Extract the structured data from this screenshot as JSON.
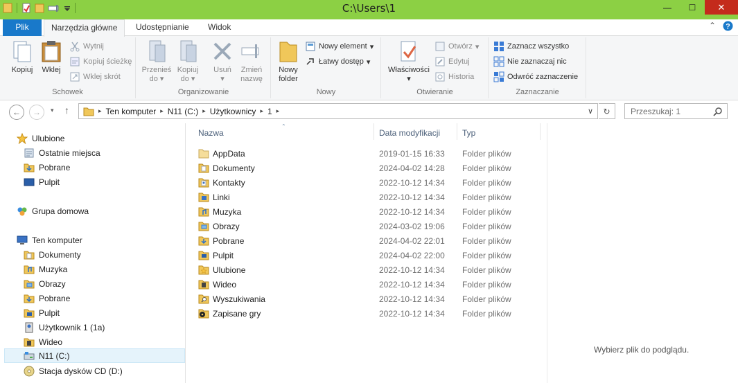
{
  "window": {
    "title": "C:\\Users\\1",
    "controls": {
      "minimize": "—",
      "maximize": "☐",
      "close": "✕"
    }
  },
  "ribbon_tabs": {
    "file": "Plik",
    "home": "Narzędzia główne",
    "share": "Udostępnianie",
    "view": "Widok"
  },
  "ribbon": {
    "clipboard": {
      "label": "Schowek",
      "copy": "Kopiuj",
      "paste": "Wklej",
      "cut": "Wytnij",
      "copy_path": "Kopiuj ścieżkę",
      "paste_shortcut": "Wklej skrót"
    },
    "organize": {
      "label": "Organizowanie",
      "move_to_l1": "Przenieś",
      "move_to_l2": "do",
      "copy_to_l1": "Kopiuj",
      "copy_to_l2": "do",
      "delete": "Usuń",
      "rename_l1": "Zmień",
      "rename_l2": "nazwę"
    },
    "new": {
      "label": "Nowy",
      "new_folder_l1": "Nowy",
      "new_folder_l2": "folder",
      "new_item": "Nowy element",
      "easy_access": "Łatwy dostęp"
    },
    "open": {
      "label": "Otwieranie",
      "properties": "Właściwości",
      "open": "Otwórz",
      "edit": "Edytuj",
      "history": "Historia"
    },
    "select": {
      "label": "Zaznaczanie",
      "select_all": "Zaznacz wszystko",
      "select_none": "Nie zaznaczaj nic",
      "invert": "Odwróć zaznaczenie"
    }
  },
  "address": {
    "crumbs": [
      "Ten komputer",
      "N11 (C:)",
      "Użytkownicy",
      "1"
    ],
    "search_placeholder": "Przeszukaj: 1"
  },
  "nav": {
    "favorites": "Ulubione",
    "recent": "Ostatnie miejsca",
    "downloads": "Pobrane",
    "desktop": "Pulpit",
    "homegroup": "Grupa domowa",
    "this_pc": "Ten komputer",
    "pc_items": [
      "Dokumenty",
      "Muzyka",
      "Obrazy",
      "Pobrane",
      "Pulpit",
      "Użytkownik 1 (1a)",
      "Wideo",
      "N11 (C:)",
      "Stacja dysków CD (D:)"
    ]
  },
  "columns": {
    "name": "Nazwa",
    "date": "Data modyfikacji",
    "type": "Typ"
  },
  "files": [
    {
      "name": "AppData",
      "date": "2019-01-15 16:33",
      "type": "Folder plików"
    },
    {
      "name": "Dokumenty",
      "date": "2024-04-02 14:28",
      "type": "Folder plików"
    },
    {
      "name": "Kontakty",
      "date": "2022-10-12 14:34",
      "type": "Folder plików"
    },
    {
      "name": "Linki",
      "date": "2022-10-12 14:34",
      "type": "Folder plików"
    },
    {
      "name": "Muzyka",
      "date": "2022-10-12 14:34",
      "type": "Folder plików"
    },
    {
      "name": "Obrazy",
      "date": "2024-03-02 19:06",
      "type": "Folder plików"
    },
    {
      "name": "Pobrane",
      "date": "2024-04-02 22:01",
      "type": "Folder plików"
    },
    {
      "name": "Pulpit",
      "date": "2024-04-02 22:00",
      "type": "Folder plików"
    },
    {
      "name": "Ulubione",
      "date": "2022-10-12 14:34",
      "type": "Folder plików"
    },
    {
      "name": "Wideo",
      "date": "2022-10-12 14:34",
      "type": "Folder plików"
    },
    {
      "name": "Wyszukiwania",
      "date": "2022-10-12 14:34",
      "type": "Folder plików"
    },
    {
      "name": "Zapisane gry",
      "date": "2022-10-12 14:34",
      "type": "Folder plików"
    }
  ],
  "preview": {
    "message": "Wybierz plik do podglądu."
  },
  "colors": {
    "titlebar": "#8cd044",
    "file_tab": "#1979ca",
    "folder": "#f0c75a",
    "close": "#c42b1c"
  }
}
